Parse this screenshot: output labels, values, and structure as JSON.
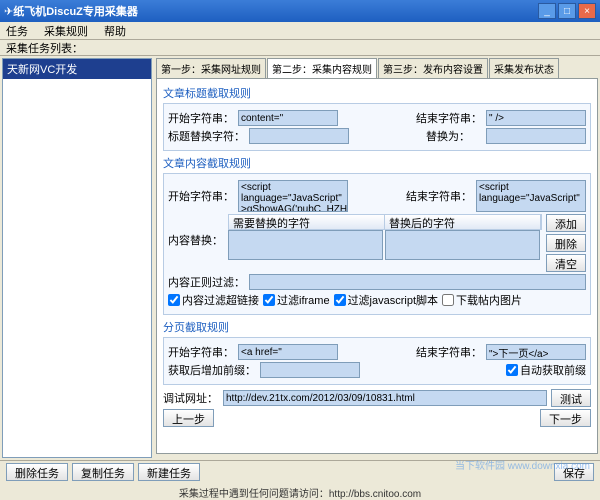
{
  "window": {
    "title": "纸飞机DiscuZ专用采集器"
  },
  "menu": {
    "task": "任务",
    "rules": "采集规则",
    "help": "帮助"
  },
  "toolbar": {
    "tasklist": "采集任务列表："
  },
  "sidebar": {
    "item": "天新网VC开发"
  },
  "tabs": {
    "t1": "第一步：采集网址规则",
    "t2": "第二步：采集内容规则",
    "t3": "第三步：发布内容设置",
    "t4": "采集发布状态"
  },
  "titleRule": {
    "heading": "文章标题截取规则",
    "startLabel": "开始字符串：",
    "startVal": "content=\"",
    "endLabel": "结束字符串：",
    "endVal": "\" />",
    "replaceLabel": "标题替换字符：",
    "replaceToLabel": "替换为："
  },
  "contentRule": {
    "heading": "文章内容截取规则",
    "startLabel": "开始字符串：",
    "startVal": "<script\nlanguage=\"JavaScript\"\n>qShowAG('pubC_HZH'",
    "endLabel": "结束字符串：",
    "endVal": "<script\nlanguage=\"JavaScript\"",
    "col1": "需要替换的字符",
    "col2": "替换后的字符",
    "replaceLabel": "内容替换：",
    "addBtn": "添加",
    "delBtn": "删除",
    "clearBtn": "清空",
    "regexLabel": "内容正则过滤：",
    "chk1": "内容过滤超链接",
    "chk2": "过滤iframe",
    "chk3": "过滤javascript脚本",
    "chk4": "下载帖内图片"
  },
  "pageRule": {
    "heading": "分页截取规则",
    "startLabel": "开始字符串：",
    "startVal": "<a href=\"",
    "endLabel": "结束字符串：",
    "endVal": "\">下一页</a>",
    "prefixLabel": "获取后增加前缀：",
    "autoPrefix": "自动获取前缀"
  },
  "test": {
    "label": "调试网址：",
    "url": "http://dev.21tx.com/2012/03/09/10831.html",
    "btn": "测试"
  },
  "nav": {
    "prev": "上一步",
    "next": "下一步"
  },
  "footer": {
    "b1": "删除任务",
    "b2": "复制任务",
    "b3": "新建任务",
    "save": "保存",
    "msg": "采集过程中遇到任何问题请访问：http://bbs.cnitoo.com"
  },
  "watermark": "当下软件园\nwww.downxia.com"
}
